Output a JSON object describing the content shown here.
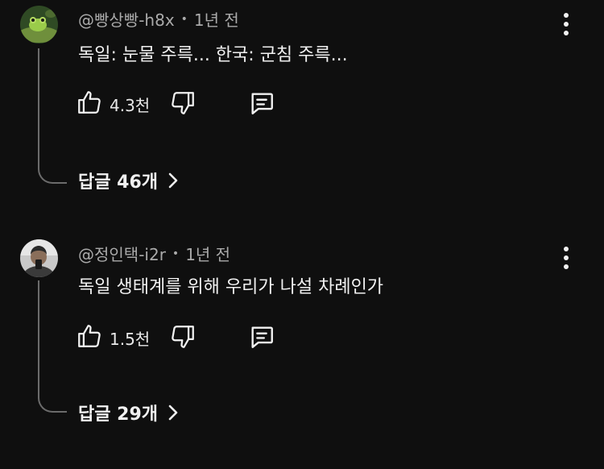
{
  "comments": [
    {
      "author": "@빵상빵-h8x",
      "separator": "•",
      "time": "1년 전",
      "text": "독일: 눈물 주륵...  한국: 군침 주륵...",
      "likes": "4.3천",
      "replies_label": "답글 46개",
      "avatar_icon": "frog-avatar-icon"
    },
    {
      "author": "@정인택-i2r",
      "separator": "•",
      "time": "1년 전",
      "text": "독일 생태계를 위해 우리가 나설 차례인가",
      "likes": "1.5천",
      "replies_label": "답글 29개",
      "avatar_icon": "person-avatar-icon"
    }
  ],
  "colors": {
    "background": "#0f0f0f",
    "primary_text": "#f1f1f1",
    "secondary_text": "#aaaaaa",
    "thread_line": "#6b6b6b"
  }
}
